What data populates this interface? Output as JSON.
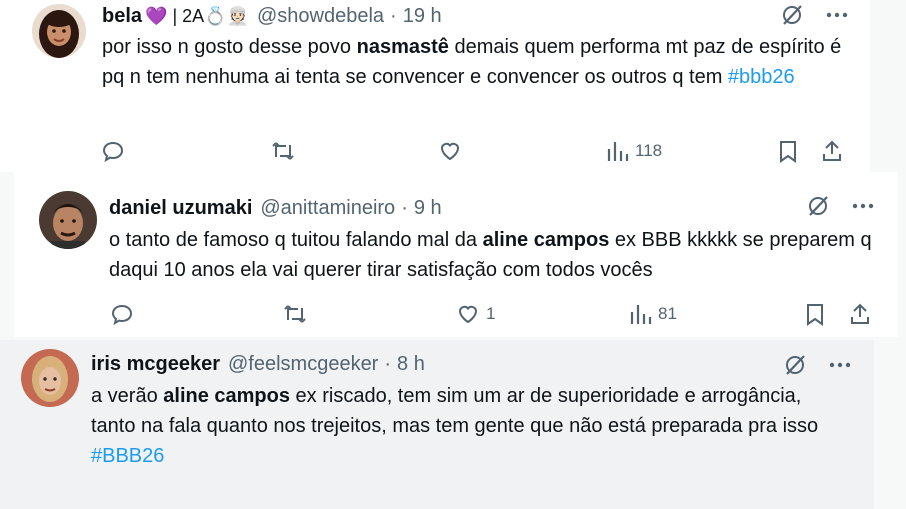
{
  "tweets": [
    {
      "name": "bela",
      "badges": "💜 | 2A💍👳🏻",
      "handle": "@showdebela",
      "dot": "·",
      "time": "19 h",
      "text_pre": "por isso n gosto desse povo ",
      "text_bold": "nasmastê",
      "text_post": " demais quem performa mt paz de espírito é pq n tem nenhuma ai tenta se convencer e convencer os outros q tem ",
      "hashtag": "#bbb26",
      "likes": "",
      "views": "118"
    },
    {
      "name": "daniel uzumaki",
      "handle": "@anittamineiro",
      "dot": "·",
      "time": "9 h",
      "text_pre": "o tanto de famoso q tuitou falando mal da ",
      "text_bold": "aline campos",
      "text_post": " ex BBB kkkkk se preparem q daqui 10 anos ela vai querer tirar satisfação com todos vocês",
      "likes": "1",
      "views": "81"
    },
    {
      "name": "iris mcgeeker",
      "handle": "@feelsmcgeeker",
      "dot": "·",
      "time": "8 h",
      "text_pre": "a verão ",
      "text_bold": "aline campos",
      "text_post": " ex riscado, tem sim um ar de superioridade e arrogância, tanto na fala quanto nos trejeitos, mas tem gente que não está preparada pra isso",
      "hashtag": "#BBB26"
    }
  ],
  "icons": [
    "grok-icon",
    "more-icon",
    "reply-icon",
    "retweet-icon",
    "like-icon",
    "views-icon",
    "bookmark-icon",
    "share-icon"
  ]
}
